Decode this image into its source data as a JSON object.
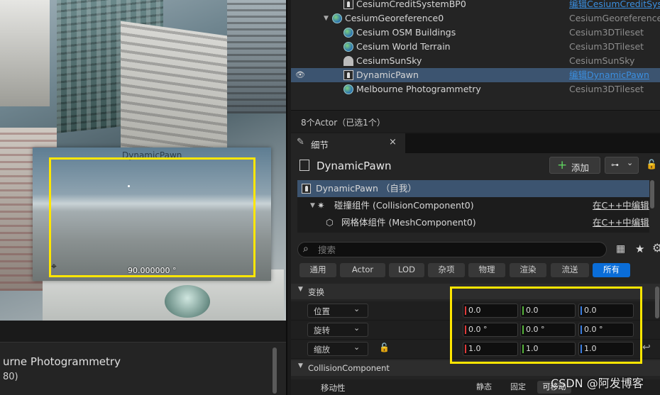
{
  "viewport": {
    "pawn_label": "DynamicPawn",
    "fov_label": "90.000000 °",
    "crosshair": "⌖",
    "asset_title": "urne Photogrammetry",
    "asset_sub": "80)"
  },
  "outliner": {
    "rows": [
      {
        "name": "CesiumCreditSystemBP0",
        "type": "编辑CesiumCreditSyst",
        "icon": "pawn-icon"
      },
      {
        "name": "CesiumGeoreference0",
        "type": "CesiumGeoreference",
        "icon": "globe-icon"
      },
      {
        "name": "Cesium OSM Buildings",
        "type": "Cesium3DTileset",
        "icon": "globe-icon"
      },
      {
        "name": "Cesium World Terrain",
        "type": "Cesium3DTileset",
        "icon": "globe-icon"
      },
      {
        "name": "CesiumSunSky",
        "type": "CesiumSunSky",
        "icon": "sun-icon"
      },
      {
        "name": "DynamicPawn",
        "type": "编辑DynamicPawn",
        "icon": "pawn-icon",
        "selected": true
      },
      {
        "name": "Melbourne Photogrammetry",
        "type": "Cesium3DTileset",
        "icon": "globe-icon"
      }
    ],
    "actor_count": "8个Actor（已选1个）",
    "eye_glyph": "👁",
    "expand_glyph": "▼"
  },
  "details": {
    "tab_label": "细节",
    "tab_close": "×",
    "tab_icon": "✎",
    "actor_name": "DynamicPawn",
    "add_label": "添加",
    "add_plus": "+",
    "bp_glyph": "⊶",
    "bp_chev": "⌄",
    "lock_glyph": "🔓",
    "component_tree": [
      {
        "name": "DynamicPawn （自我）",
        "edit": ""
      },
      {
        "name": "碰撞组件 (CollisionComponent0)",
        "edit": "在C++中编辑"
      },
      {
        "name": "网格体组件 (MeshComponent0)",
        "edit": "在C++中编辑"
      }
    ],
    "search_placeholder": "搜索",
    "search_glyph": "⌕",
    "grid_glyph": "▦",
    "star_glyph": "★",
    "gear_glyph": "⚙",
    "filters": [
      "通用",
      "Actor",
      "LOD",
      "杂项",
      "物理",
      "渲染",
      "流送",
      "所有"
    ],
    "active_filter": "所有",
    "transform_title": "变换",
    "cat_arrow": "▼",
    "transform_rows": [
      {
        "label": "位置",
        "x": "0.0",
        "y": "0.0",
        "z": "0.0"
      },
      {
        "label": "旋转",
        "x": "0.0 °",
        "y": "0.0 °",
        "z": "0.0 °"
      },
      {
        "label": "缩放",
        "x": "1.0",
        "y": "1.0",
        "z": "1.0"
      }
    ],
    "dd_chev": "⌄",
    "reset_glyph": "↩",
    "collision_title": "CollisionComponent",
    "mobility_label": "移动性",
    "mobility_options": [
      "静态",
      "固定",
      "可移动"
    ],
    "mobility_selected": "可移动"
  },
  "watermark": "CSDN @阿发博客",
  "colors": {
    "highlight": "#ffe600",
    "selection": "#3c5470",
    "active_filter": "#0a6dd8",
    "link": "#3b8fe0"
  }
}
